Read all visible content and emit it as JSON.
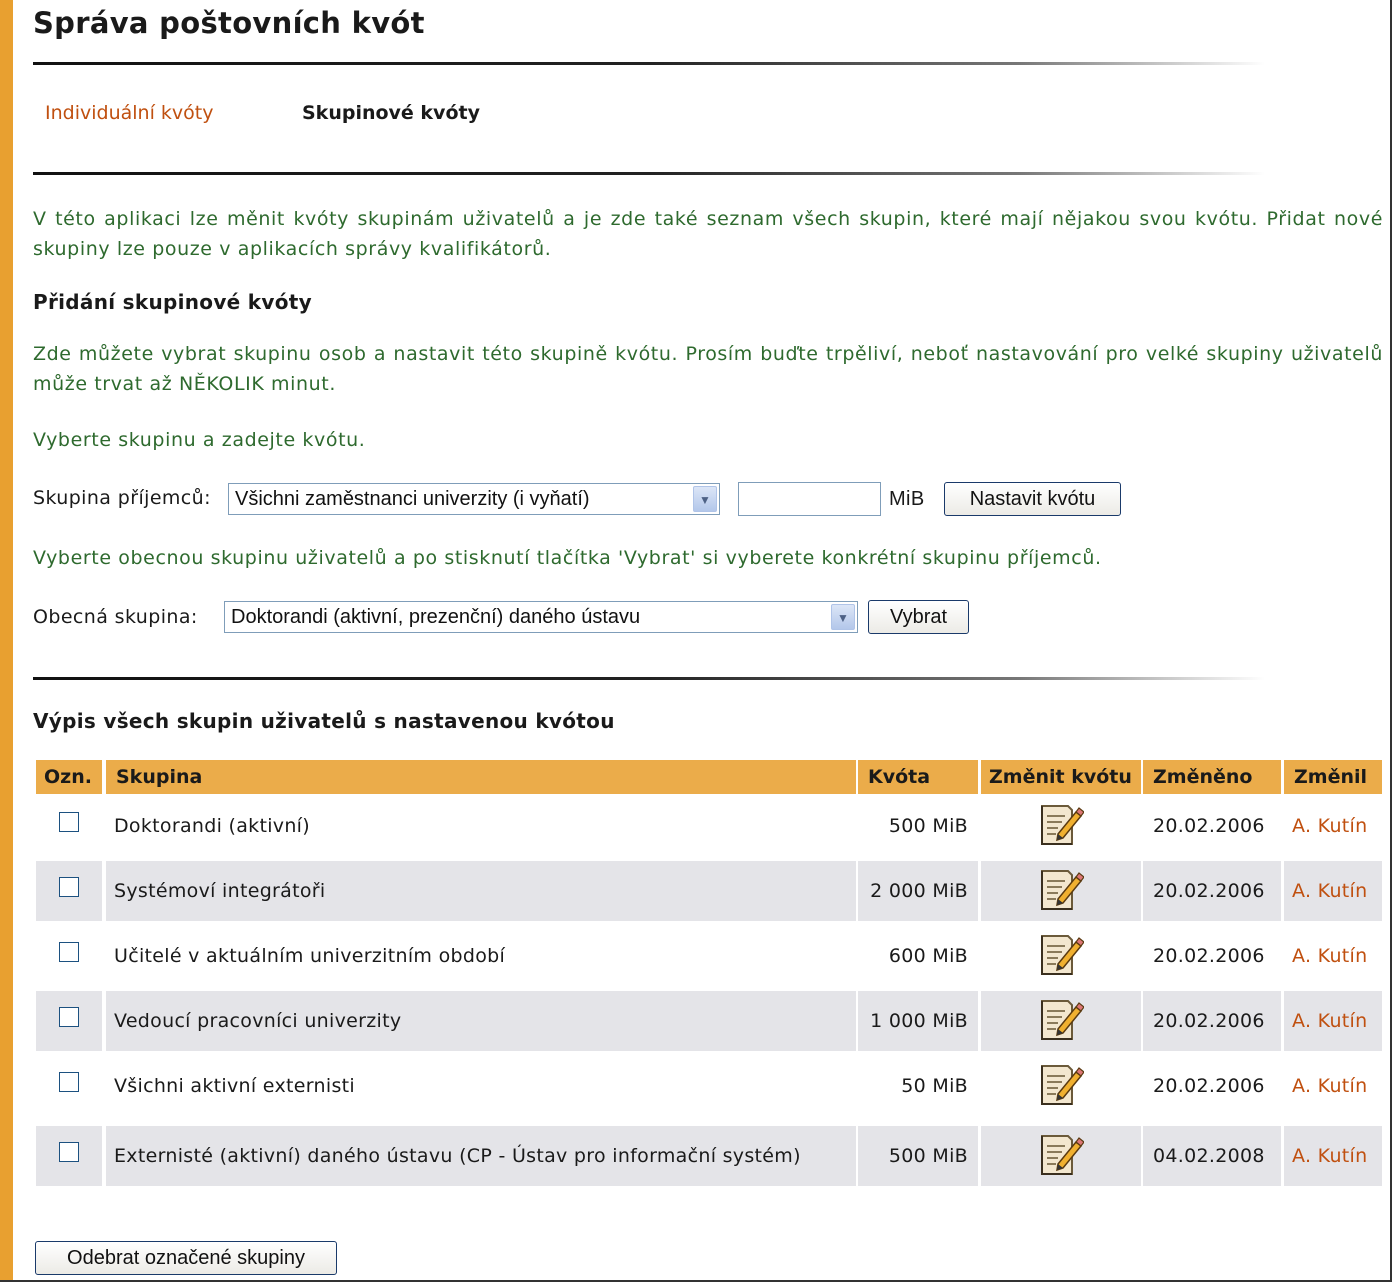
{
  "page": {
    "title": "Správa poštovních kvót"
  },
  "tabs": {
    "individual": "Individuální kvóty",
    "group": "Skupinové kvóty"
  },
  "intro": "V této aplikaci lze měnit kvóty skupinám uživatelů a je zde také seznam všech skupin, které mají nějakou svou kvótu. Přidat nové skupiny lze pouze v aplikacích správy kvalifikátorů.",
  "add_section": {
    "heading": "Přidání skupinové kvóty",
    "description": "Zde můžete vybrat skupinu osob a nastavit této skupině kvótu. Prosím buďte trpěliví, neboť nastavování pro velké skupiny uživatelů může trvat až NĚKOLIK minut.",
    "instruction": "Vyberte skupinu a zadejte kvótu.",
    "recipient_label": "Skupina příjemců:",
    "recipient_selected": "Všichni zaměstnanci univerzity (i vyňatí)",
    "quota_value": "",
    "unit": "MiB",
    "set_button": "Nastavit kvótu",
    "general_instruction": "Vyberte obecnou skupinu uživatelů a po stisknutí tlačítka 'Vybrat' si vyberete konkrétní skupinu příjemců.",
    "general_label": "Obecná skupina:",
    "general_selected": "Doktorandi (aktivní, prezenční) daného ústavu",
    "select_button": "Vybrat"
  },
  "list_section": {
    "heading": "Výpis všech skupin uživatelů s nastavenou kvótou",
    "columns": [
      "Ozn.",
      "Skupina",
      "Kvóta",
      "Změnit kvótu",
      "Změněno",
      "Změnil"
    ],
    "rows": [
      {
        "group": "Doktorandi (aktivní)",
        "quota": "500 MiB",
        "changed": "20.02.2006",
        "by": "A. Kutín"
      },
      {
        "group": "Systémoví integrátoři",
        "quota": "2 000 MiB",
        "changed": "20.02.2006",
        "by": "A. Kutín"
      },
      {
        "group": "Učitelé v aktuálním univerzitním období",
        "quota": "600 MiB",
        "changed": "20.02.2006",
        "by": "A. Kutín"
      },
      {
        "group": "Vedoucí pracovníci univerzity",
        "quota": "1 000 MiB",
        "changed": "20.02.2006",
        "by": "A. Kutín"
      },
      {
        "group": "Všichni aktivní externisti",
        "quota": "50 MiB",
        "changed": "20.02.2006",
        "by": "A. Kutín"
      },
      {
        "group": "Externisté (aktivní) daného ústavu (CP - Ústav pro informační systém)",
        "quota": "500 MiB",
        "changed": "04.02.2008",
        "by": "A. Kutín"
      }
    ],
    "remove_button": "Odebrat označené skupiny"
  },
  "colors": {
    "accent": "#e8a030",
    "header_bg": "#ebac4a",
    "link": "#c05010",
    "info_text": "#2e6a2e",
    "alt_row": "#e4e4e8"
  },
  "icons": {
    "edit": "edit-note-icon",
    "dropdown": "chevron-down-icon"
  }
}
